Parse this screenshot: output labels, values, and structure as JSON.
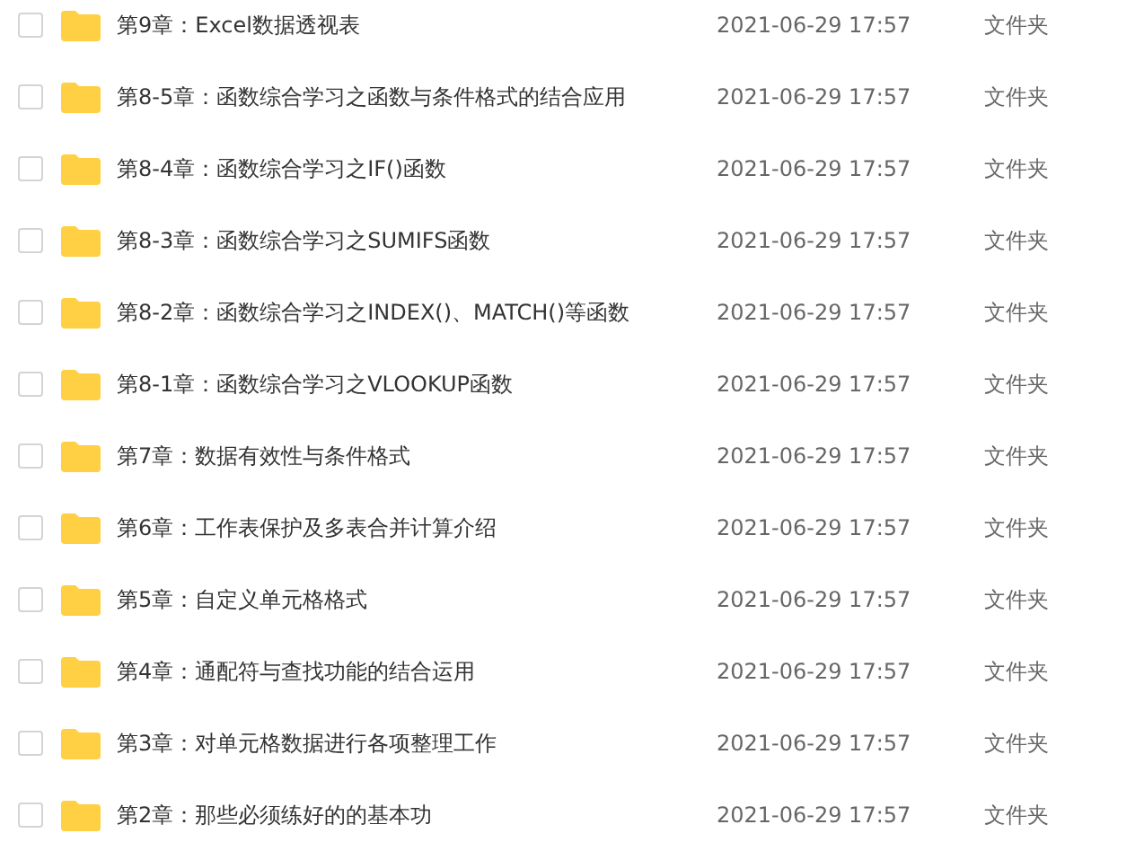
{
  "files": [
    {
      "name": "第9章：Excel数据透视表",
      "modified": "2021-06-29 17:57",
      "type": "文件夹",
      "checked": false
    },
    {
      "name": "第8-5章：函数综合学习之函数与条件格式的结合应用",
      "modified": "2021-06-29 17:57",
      "type": "文件夹",
      "checked": false
    },
    {
      "name": "第8-4章：函数综合学习之IF()函数",
      "modified": "2021-06-29 17:57",
      "type": "文件夹",
      "checked": false
    },
    {
      "name": "第8-3章：函数综合学习之SUMIFS函数",
      "modified": "2021-06-29 17:57",
      "type": "文件夹",
      "checked": false
    },
    {
      "name": "第8-2章：函数综合学习之INDEX()、MATCH()等函数",
      "modified": "2021-06-29 17:57",
      "type": "文件夹",
      "checked": false
    },
    {
      "name": "第8-1章：函数综合学习之VLOOKUP函数",
      "modified": "2021-06-29 17:57",
      "type": "文件夹",
      "checked": false
    },
    {
      "name": "第7章：数据有效性与条件格式",
      "modified": "2021-06-29 17:57",
      "type": "文件夹",
      "checked": false
    },
    {
      "name": "第6章：工作表保护及多表合并计算介绍",
      "modified": "2021-06-29 17:57",
      "type": "文件夹",
      "checked": false
    },
    {
      "name": "第5章：自定义单元格格式",
      "modified": "2021-06-29 17:57",
      "type": "文件夹",
      "checked": false
    },
    {
      "name": "第4章：通配符与查找功能的结合运用",
      "modified": "2021-06-29 17:57",
      "type": "文件夹",
      "checked": false
    },
    {
      "name": "第3章：对单元格数据进行各项整理工作",
      "modified": "2021-06-29 17:57",
      "type": "文件夹",
      "checked": false
    },
    {
      "name": "第2章：那些必须练好的的基本功",
      "modified": "2021-06-29 17:57",
      "type": "文件夹",
      "checked": false
    }
  ]
}
